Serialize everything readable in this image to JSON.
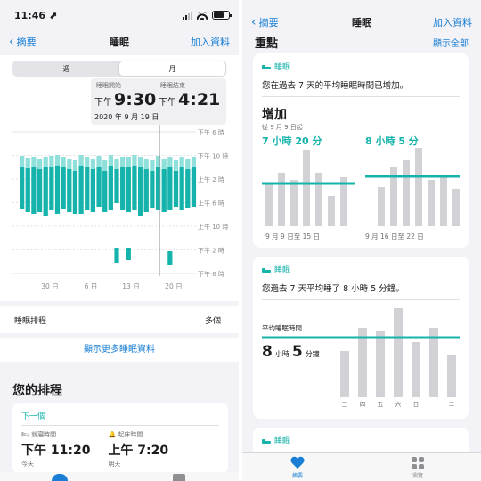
{
  "left": {
    "status": {
      "time": "11:46 ⬈"
    },
    "nav": {
      "back": "摘要",
      "title": "睡眠",
      "action": "加入資料"
    },
    "segments": {
      "week": "週",
      "month": "月"
    },
    "tooltip": {
      "start_label": "睡眠開始",
      "end_label": "睡眠結束",
      "start_ampm": "下午",
      "start_time": "9:30",
      "end_ampm": "下午",
      "end_time": "4:21",
      "date": "2020 年 9 月 19 日"
    },
    "chart": {
      "y_labels": [
        "下午 6 時",
        "下午 10 時",
        "上午 2 時",
        "上午 6 時",
        "上午 10 時",
        "下午 2 時",
        "下午 6 時"
      ],
      "x_labels": [
        "30 日",
        "6 日",
        "13 日",
        "20 日"
      ]
    },
    "schedule_row": {
      "label": "睡眠排程",
      "value": "多個"
    },
    "more_link": "顯示更多睡眠資料",
    "section_title": "您的排程",
    "schedule_card": {
      "next": "下一個",
      "bed_label": "就寢時間",
      "bed_time": "下午 11:20",
      "bed_day": "今天",
      "wake_label": "起床時間",
      "wake_time": "上午 7:20",
      "wake_day": "明天"
    }
  },
  "right": {
    "status": {
      "time": ""
    },
    "nav": {
      "back": "摘要",
      "title": "睡眠",
      "action": "加入資料"
    },
    "header": {
      "title": "重點",
      "action": "顯示全部"
    },
    "card1": {
      "category": "睡眠",
      "sentence": "您在過去 7 天的平均睡眠時間已增加。",
      "headline": "增加",
      "since": "從 9 月 9 日起",
      "avg_a": "7 小時 20 分",
      "avg_b": "8 小時 5 分",
      "range_a": "9 月 9 日至 15 日",
      "range_b": "9 月 16 日至 22 日"
    },
    "card2": {
      "category": "睡眠",
      "sentence": "您過去 7 天平均睡了 8 小時 5 分鐘。",
      "sub_label": "平均睡眠時間",
      "hours": "8",
      "hours_unit": "小時",
      "minutes": "5",
      "minutes_unit": "分鐘",
      "days": [
        "三",
        "四",
        "五",
        "六",
        "日",
        "一",
        "二"
      ]
    },
    "card3": {
      "category": "睡眠"
    },
    "tabs": {
      "summary": "摘要",
      "browse": "瀏覽"
    }
  },
  "colors": {
    "accent": "#1a7fd4",
    "teal": "#15b3ab",
    "gray_bar": "#d1d1d6"
  }
}
